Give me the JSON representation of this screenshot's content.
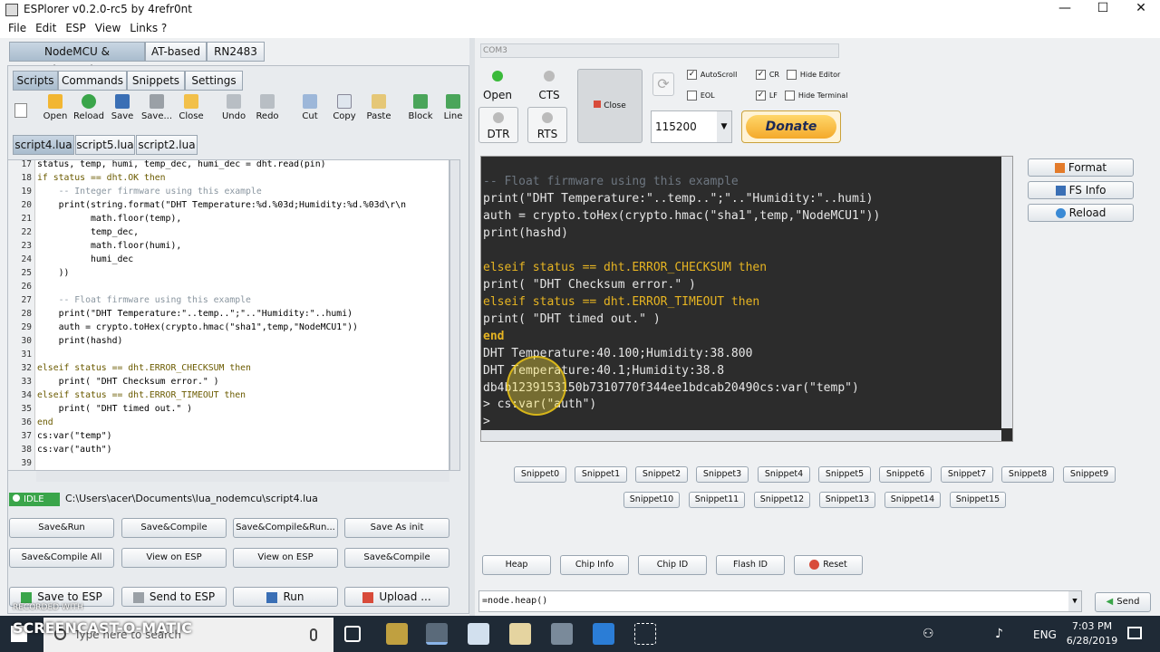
{
  "window": {
    "title": "ESPlorer v0.2.0-rc5 by 4refr0nt"
  },
  "menu": [
    "File",
    "Edit",
    "ESP",
    "View",
    "Links ?"
  ],
  "firmware_tabs": [
    "NodeMCU & MicroPython",
    "AT-based",
    "RN2483"
  ],
  "sub_tabs": [
    "Scripts",
    "Commands",
    "Snippets",
    "Settings"
  ],
  "toolbar": [
    "Open",
    "Reload",
    "Save",
    "Save...",
    "Close",
    "Undo",
    "Redo",
    "Cut",
    "Copy",
    "Paste",
    "Block",
    "Line"
  ],
  "file_tabs": [
    "script4.lua",
    "script5.lua",
    "script2.lua"
  ],
  "editor": {
    "line_numbers": [
      "17",
      "18",
      "19",
      "20",
      "21",
      "22",
      "23",
      "24",
      "25",
      "26",
      "27",
      "28",
      "29",
      "30",
      "31",
      "32",
      "33",
      "34",
      "35",
      "36",
      "37",
      "38",
      "39"
    ],
    "lines": [
      "status, temp, humi, temp_dec, humi_dec = dht.read(pin)",
      "if status == dht.OK then",
      "    -- Integer firmware using this example",
      "    print(string.format(\"DHT Temperature:%d.%03d;Humidity:%d.%03d\\r\\n",
      "          math.floor(temp),",
      "          temp_dec,",
      "          math.floor(humi),",
      "          humi_dec",
      "    ))",
      "",
      "    -- Float firmware using this example",
      "    print(\"DHT Temperature:\"..temp..\";\"..\"Humidity:\"..humi)",
      "    auth = crypto.toHex(crypto.hmac(\"sha1\",temp,\"NodeMCU1\"))",
      "    print(hashd)",
      "",
      "elseif status == dht.ERROR_CHECKSUM then",
      "    print( \"DHT Checksum error.\" )",
      "elseif status == dht.ERROR_TIMEOUT then",
      "    print( \"DHT timed out.\" )",
      "end",
      "cs:var(\"temp\")",
      "cs:var(\"auth\")",
      ""
    ]
  },
  "status": {
    "state": "IDLE",
    "path": "C:\\Users\\acer\\Documents\\lua_nodemcu\\script4.lua"
  },
  "left_buttons_row1": [
    "Save&Run",
    "Save&Compile",
    "Save&Compile&Run...",
    "Save As init"
  ],
  "left_buttons_row2": [
    "Save&Compile All",
    "View on ESP",
    "View on ESP",
    "Save&Compile"
  ],
  "left_bottom": [
    "Save to ESP",
    "Send to ESP",
    "Run",
    "Upload ..."
  ],
  "port": {
    "name": "COM3",
    "baud": "115200"
  },
  "serial": {
    "open": "Open",
    "cts": "CTS",
    "close": "Close",
    "dtr": "DTR",
    "rts": "RTS"
  },
  "checks": {
    "autoscroll": "AutoScroll",
    "cr": "CR",
    "hide_editor": "Hide Editor",
    "eol": "EOL",
    "lf": "LF",
    "hide_terminal": "Hide Terminal"
  },
  "donate": "Donate",
  "side_buttons": [
    "Format",
    "FS Info",
    "Reload"
  ],
  "terminal": {
    "lines": [
      "-- Float firmware using this example",
      "print(\"DHT Temperature:\"..temp..\";\"..\"Humidity:\"..humi)",
      "auth = crypto.toHex(crypto.hmac(\"sha1\",temp,\"NodeMCU1\"))",
      "print(hashd)",
      "",
      "elseif status == dht.ERROR_CHECKSUM then",
      "print( \"DHT Checksum error.\" )",
      "elseif status == dht.ERROR_TIMEOUT then",
      "print( \"DHT timed out.\" )",
      "end",
      "DHT Temperature:40.100;Humidity:38.800",
      "DHT Temperature:40.1;Humidity:38.8",
      "db4b1239153150b7310770f344ee1bdcab20490cs:var(\"temp\")",
      "> cs:var(\"auth\")",
      ">"
    ]
  },
  "snippets_row1": [
    "Snippet0",
    "Snippet1",
    "Snippet2",
    "Snippet3",
    "Snippet4",
    "Snippet5",
    "Snippet6",
    "Snippet7",
    "Snippet8",
    "Snippet9"
  ],
  "snippets_row2": [
    "Snippet10",
    "Snippet11",
    "Snippet12",
    "Snippet13",
    "Snippet14",
    "Snippet15"
  ],
  "bottom_buttons": [
    "Heap",
    "Chip Info",
    "Chip ID",
    "Flash ID",
    "Reset"
  ],
  "command": {
    "value": "=node.heap()",
    "send": "Send"
  },
  "taskbar": {
    "search_placeholder": "Type here to search",
    "lang": "ENG",
    "time": "7:03 PM",
    "date": "6/28/2019"
  },
  "watermark": {
    "line1": "RECORDED WITH",
    "line2": "SCREENCAST-O-MATIC"
  }
}
